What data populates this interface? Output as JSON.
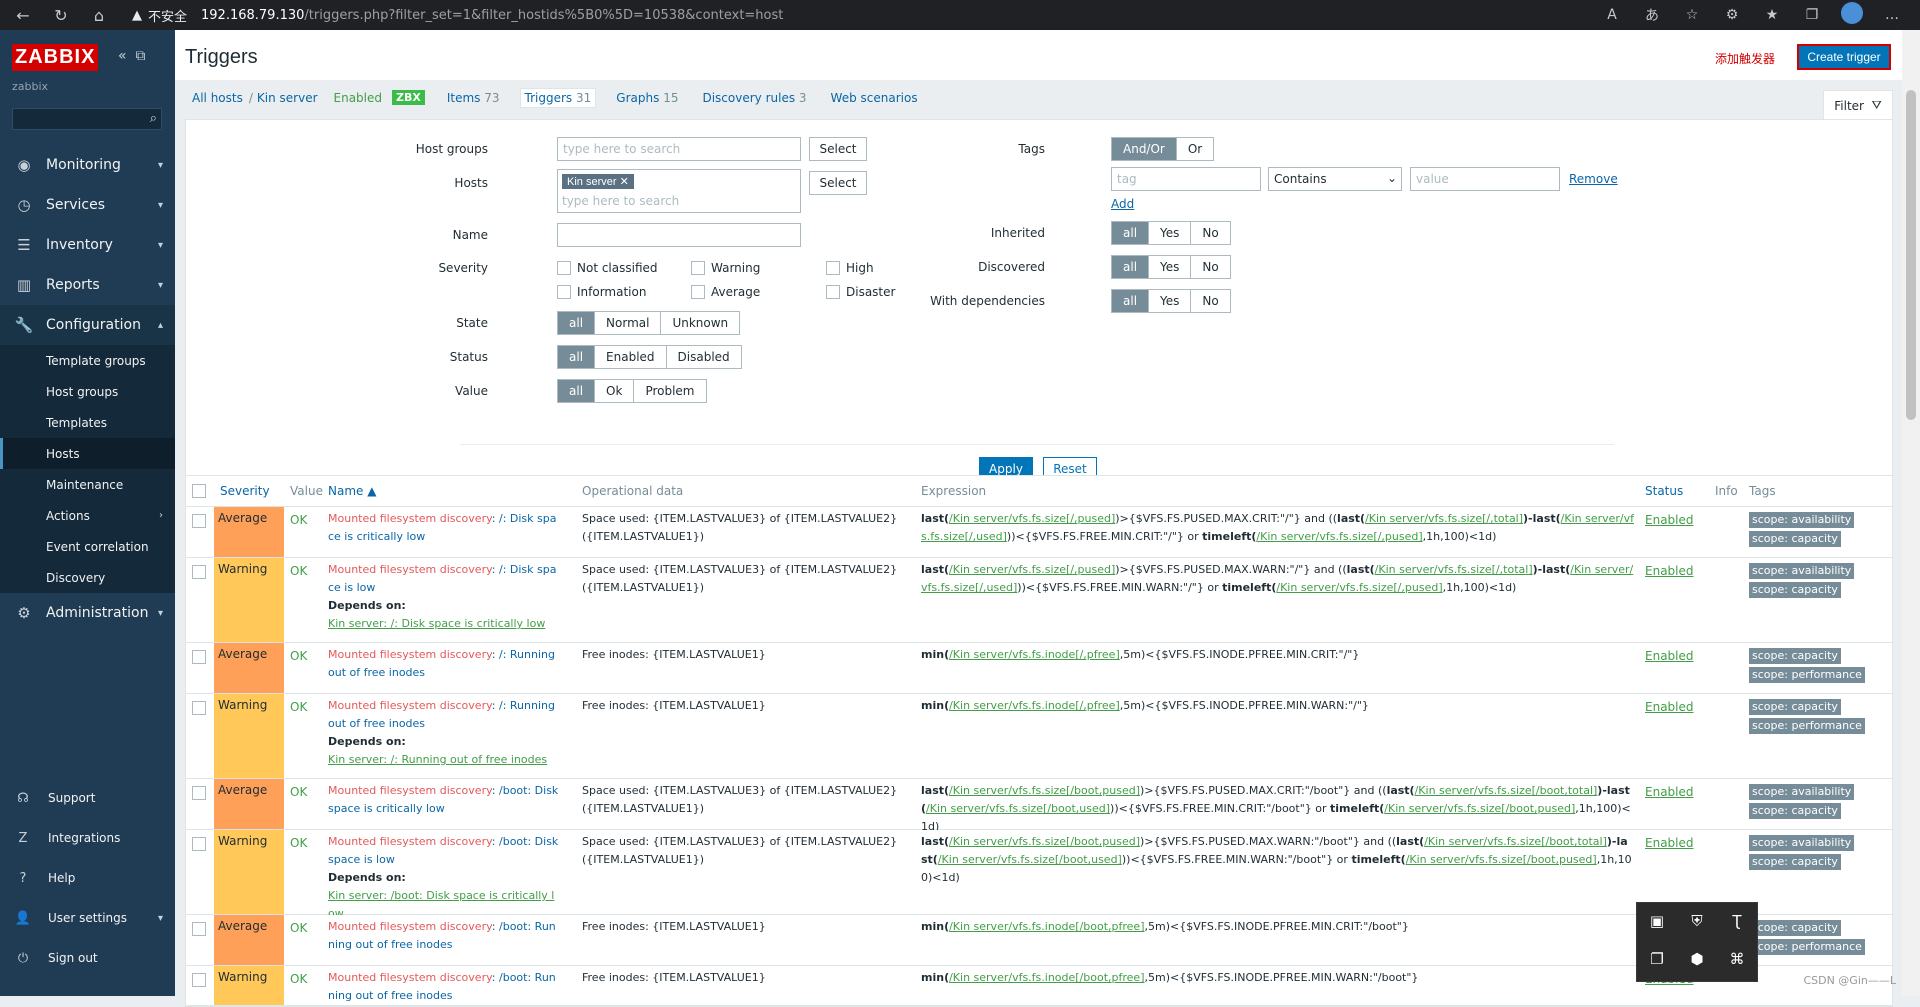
{
  "browser": {
    "warn_label": "不安全",
    "url_host": "192.168.79.130",
    "url_path": "/triggers.php?filter_set=1&filter_hostids%5B0%5D=10538&context=host"
  },
  "sidebar": {
    "logo": "ZABBIX",
    "server": "zabbix",
    "menu": [
      {
        "label": "Monitoring",
        "icon": "eye-icon"
      },
      {
        "label": "Services",
        "icon": "clock-icon"
      },
      {
        "label": "Inventory",
        "icon": "list-icon"
      },
      {
        "label": "Reports",
        "icon": "chart-icon"
      },
      {
        "label": "Configuration",
        "icon": "wrench-icon"
      }
    ],
    "config_sub": [
      "Template groups",
      "Host groups",
      "Templates",
      "Hosts",
      "Maintenance",
      "Actions",
      "Event correlation",
      "Discovery"
    ],
    "admin": "Administration",
    "bottom": [
      "Support",
      "Integrations",
      "Help",
      "User settings",
      "Sign out"
    ]
  },
  "header": {
    "title": "Triggers",
    "annotation": "添加触发器",
    "create_btn": "Create trigger"
  },
  "breadcrumb": {
    "all_hosts": "All hosts",
    "sep": "/",
    "host": "Kin server",
    "enabled": "Enabled",
    "zbx": "ZBX",
    "tabs": [
      {
        "label": "Items",
        "count": "73"
      },
      {
        "label": "Triggers",
        "count": "31"
      },
      {
        "label": "Graphs",
        "count": "15"
      },
      {
        "label": "Discovery rules",
        "count": "3"
      },
      {
        "label": "Web scenarios",
        "count": ""
      }
    ],
    "filter": "Filter"
  },
  "filter": {
    "host_groups_label": "Host groups",
    "search_placeholder": "type here to search",
    "select": "Select",
    "hosts_label": "Hosts",
    "host_chip": "Kin server",
    "name_label": "Name",
    "severity_label": "Severity",
    "severities": [
      "Not classified",
      "Warning",
      "High",
      "Information",
      "Average",
      "Disaster"
    ],
    "state_label": "State",
    "state_opts": [
      "all",
      "Normal",
      "Unknown"
    ],
    "status_label": "Status",
    "status_opts": [
      "all",
      "Enabled",
      "Disabled"
    ],
    "value_label": "Value",
    "value_opts": [
      "all",
      "Ok",
      "Problem"
    ],
    "tags_label": "Tags",
    "tag_ops": [
      "And/Or",
      "Or"
    ],
    "tag_placeholder": "tag",
    "contains": "Contains",
    "value_placeholder": "value",
    "remove": "Remove",
    "add": "Add",
    "inherited_label": "Inherited",
    "discovered_label": "Discovered",
    "withdeps_label": "With dependencies",
    "yn": [
      "all",
      "Yes",
      "No"
    ],
    "apply": "Apply",
    "reset": "Reset"
  },
  "table": {
    "headers": [
      "Severity",
      "Value",
      "Name ▲",
      "Operational data",
      "Expression",
      "Status",
      "Info",
      "Tags"
    ],
    "rows": [
      {
        "severity": "Average",
        "value": "OK",
        "disc": "Mounted filesystem discovery",
        "name": ": /: Disk space is critically low",
        "dep": "",
        "op": "Space used: {ITEM.LASTVALUE3} of {ITEM.LASTVALUE2} ({ITEM.LASTVALUE1})",
        "expr": [
          [
            "b",
            "last("
          ],
          [
            "k",
            "/Kin server/vfs.fs.size[/,pused]"
          ],
          [
            "t",
            ")>{$VFS.FS.PUSED.MAX.CRIT:\"/\"} and (("
          ],
          [
            "b",
            "last("
          ],
          [
            "k",
            "/Kin server/vfs.fs.size[/,total]"
          ],
          [
            "b",
            ")-last("
          ],
          [
            "k",
            "/Kin server/vfs.fs.size[/,used]"
          ],
          [
            "t",
            "))<{$VFS.FS.FREE.MIN.CRIT:\"/\"} or "
          ],
          [
            "b",
            "timeleft("
          ],
          [
            "k",
            "/Kin server/vfs.fs.size[/,pused]"
          ],
          [
            "t",
            ",1h,100)<1d)"
          ]
        ],
        "status": "Enabled",
        "tags": [
          "scope: availability",
          "scope: capacity"
        ]
      },
      {
        "severity": "Warning",
        "value": "OK",
        "disc": "Mounted filesystem discovery",
        "name": ": /: Disk space is low",
        "dep": "Kin server: /: Disk space is critically low",
        "op": "Space used: {ITEM.LASTVALUE3} of {ITEM.LASTVALUE2} ({ITEM.LASTVALUE1})",
        "expr": [
          [
            "b",
            "last("
          ],
          [
            "k",
            "/Kin server/vfs.fs.size[/,pused]"
          ],
          [
            "t",
            ")>{$VFS.FS.PUSED.MAX.WARN:\"/\"} and (("
          ],
          [
            "b",
            "last("
          ],
          [
            "k",
            "/Kin server/vfs.fs.size[/,total]"
          ],
          [
            "b",
            ")-last("
          ],
          [
            "k",
            "/Kin server/vfs.fs.size[/,used]"
          ],
          [
            "t",
            "))<{$VFS.FS.FREE.MIN.WARN:\"/\"} or "
          ],
          [
            "b",
            "timeleft("
          ],
          [
            "k",
            "/Kin server/vfs.fs.size[/,pused]"
          ],
          [
            "t",
            ",1h,100)<1d)"
          ]
        ],
        "status": "Enabled",
        "tags": [
          "scope: availability",
          "scope: capacity"
        ]
      },
      {
        "severity": "Average",
        "value": "OK",
        "disc": "Mounted filesystem discovery",
        "name": ": /: Running out of free inodes",
        "dep": "",
        "op": "Free inodes: {ITEM.LASTVALUE1}",
        "expr": [
          [
            "b",
            "min("
          ],
          [
            "k",
            "/Kin server/vfs.fs.inode[/,pfree]"
          ],
          [
            "t",
            ",5m)<{$VFS.FS.INODE.PFREE.MIN.CRIT:\"/\"}"
          ]
        ],
        "status": "Enabled",
        "tags": [
          "scope: capacity",
          "scope: performance"
        ]
      },
      {
        "severity": "Warning",
        "value": "OK",
        "disc": "Mounted filesystem discovery",
        "name": ": /: Running out of free inodes",
        "dep": "Kin server: /: Running out of free inodes",
        "op": "Free inodes: {ITEM.LASTVALUE1}",
        "expr": [
          [
            "b",
            "min("
          ],
          [
            "k",
            "/Kin server/vfs.fs.inode[/,pfree]"
          ],
          [
            "t",
            ",5m)<{$VFS.FS.INODE.PFREE.MIN.WARN:\"/\"}"
          ]
        ],
        "status": "Enabled",
        "tags": [
          "scope: capacity",
          "scope: performance"
        ]
      },
      {
        "severity": "Average",
        "value": "OK",
        "disc": "Mounted filesystem discovery",
        "name": ": /boot: Disk space is critically low",
        "dep": "",
        "op": "Space used: {ITEM.LASTVALUE3} of {ITEM.LASTVALUE2} ({ITEM.LASTVALUE1})",
        "expr": [
          [
            "b",
            "last("
          ],
          [
            "k",
            "/Kin server/vfs.fs.size[/boot,pused]"
          ],
          [
            "t",
            ")>{$VFS.FS.PUSED.MAX.CRIT:\"/boot\"} and (("
          ],
          [
            "b",
            "last("
          ],
          [
            "k",
            "/Kin server/vfs.fs.size[/boot,total]"
          ],
          [
            "b",
            ")-last("
          ],
          [
            "k",
            "/Kin server/vfs.fs.size[/boot,used]"
          ],
          [
            "t",
            "))<{$VFS.FS.FREE.MIN.CRIT:\"/boot\"} or "
          ],
          [
            "b",
            "timeleft("
          ],
          [
            "k",
            "/Kin server/vfs.fs.size[/boot,pused]"
          ],
          [
            "t",
            ",1h,100)<1d)"
          ]
        ],
        "status": "Enabled",
        "tags": [
          "scope: availability",
          "scope: capacity"
        ]
      },
      {
        "severity": "Warning",
        "value": "OK",
        "disc": "Mounted filesystem discovery",
        "name": ": /boot: Disk space is low",
        "dep": "Kin server: /boot: Disk space is critically low",
        "op": "Space used: {ITEM.LASTVALUE3} of {ITEM.LASTVALUE2} ({ITEM.LASTVALUE1})",
        "expr": [
          [
            "b",
            "last("
          ],
          [
            "k",
            "/Kin server/vfs.fs.size[/boot,pused]"
          ],
          [
            "t",
            ")>{$VFS.FS.PUSED.MAX.WARN:\"/boot\"} and (("
          ],
          [
            "b",
            "last("
          ],
          [
            "k",
            "/Kin server/vfs.fs.size[/boot,total]"
          ],
          [
            "b",
            ")-last("
          ],
          [
            "k",
            "/Kin server/vfs.fs.size[/boot,used]"
          ],
          [
            "t",
            "))<{$VFS.FS.FREE.MIN.WARN:\"/boot\"} or "
          ],
          [
            "b",
            "timeleft("
          ],
          [
            "k",
            "/Kin server/vfs.fs.size[/boot,pused]"
          ],
          [
            "t",
            ",1h,100)<1d)"
          ]
        ],
        "status": "Enabled",
        "tags": [
          "scope: availability",
          "scope: capacity"
        ]
      },
      {
        "severity": "Average",
        "value": "OK",
        "disc": "Mounted filesystem discovery",
        "name": ": /boot: Running out of free inodes",
        "dep": "",
        "op": "Free inodes: {ITEM.LASTVALUE1}",
        "expr": [
          [
            "b",
            "min("
          ],
          [
            "k",
            "/Kin server/vfs.fs.inode[/boot,pfree]"
          ],
          [
            "t",
            ",5m)<{$VFS.FS.INODE.PFREE.MIN.CRIT:\"/boot\"}"
          ]
        ],
        "status": "Enabled",
        "tags": [
          "scope: capacity",
          "scope: performance"
        ]
      },
      {
        "severity": "Warning",
        "value": "OK",
        "disc": "Mounted filesystem discovery",
        "name": ": /boot: Running out of free inodes",
        "dep": "",
        "op": "Free inodes: {ITEM.LASTVALUE1}",
        "expr": [
          [
            "b",
            "min("
          ],
          [
            "k",
            "/Kin server/vfs.fs.inode[/boot,pfree]"
          ],
          [
            "t",
            ",5m)<{$VFS.FS.INODE.PFREE.MIN.WARN:\"/boot\"}"
          ]
        ],
        "status": "Enabled",
        "tags": []
      }
    ],
    "depends_label": "Depends on:"
  },
  "watermark": "CSDN @Gin——L"
}
